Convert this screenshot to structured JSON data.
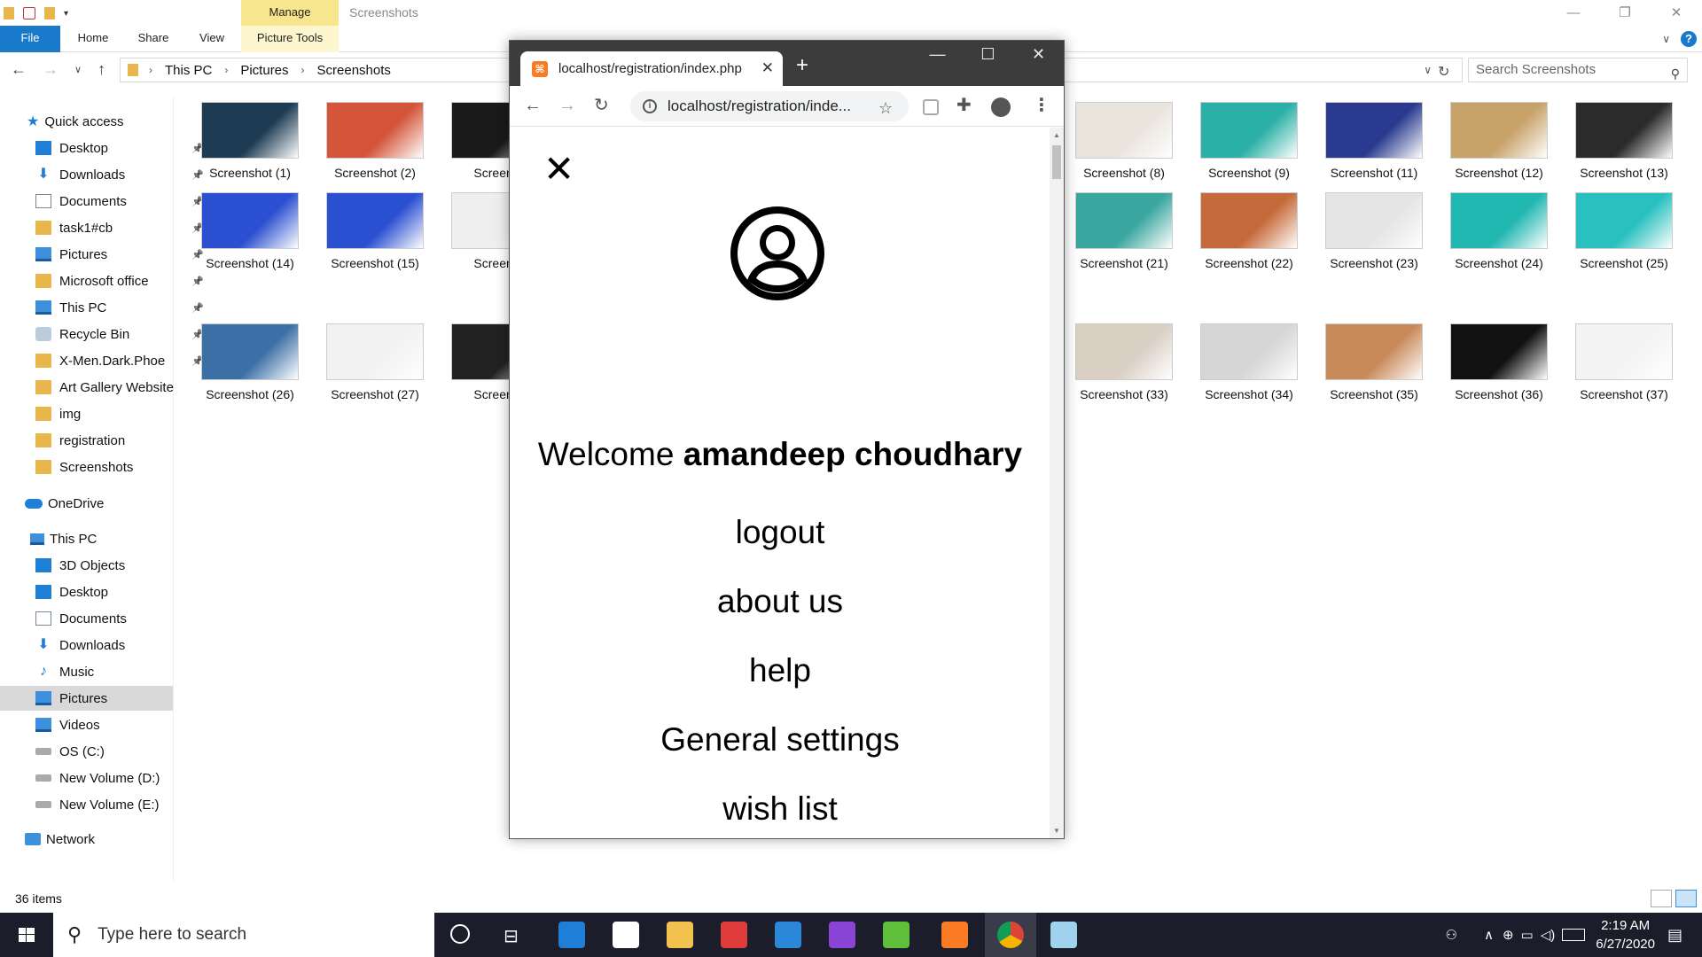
{
  "explorer": {
    "title": "Screenshots",
    "ribbon": {
      "contextual_tab": "Manage",
      "tabs": [
        "File",
        "Home",
        "Share",
        "View",
        "Picture Tools"
      ]
    },
    "breadcrumb": [
      "This PC",
      "Pictures",
      "Screenshots"
    ],
    "search_placeholder": "Search Screenshots",
    "nav": {
      "quick_access_label": "Quick access",
      "quick_access": [
        {
          "label": "Desktop",
          "icon": "desktop-icon",
          "pinned": true
        },
        {
          "label": "Downloads",
          "icon": "downloads-icon",
          "pinned": true
        },
        {
          "label": "Documents",
          "icon": "documents-icon",
          "pinned": true
        },
        {
          "label": "task1#cb",
          "icon": "folder-icon",
          "pinned": true
        },
        {
          "label": "Pictures",
          "icon": "pictures-icon",
          "pinned": true
        },
        {
          "label": "Microsoft office",
          "icon": "folder-icon",
          "pinned": true
        },
        {
          "label": "This PC",
          "icon": "this-pc-icon",
          "pinned": true
        },
        {
          "label": "Recycle Bin",
          "icon": "recycle-bin-icon",
          "pinned": true
        },
        {
          "label": "X-Men.Dark.Phoe",
          "icon": "folder-icon",
          "pinned": true
        },
        {
          "label": "Art Gallery Website",
          "icon": "folder-icon",
          "pinned": false
        },
        {
          "label": "img",
          "icon": "folder-icon",
          "pinned": false
        },
        {
          "label": "registration",
          "icon": "folder-icon",
          "pinned": false
        },
        {
          "label": "Screenshots",
          "icon": "folder-icon",
          "pinned": false
        }
      ],
      "onedrive_label": "OneDrive",
      "this_pc_label": "This PC",
      "this_pc": [
        {
          "label": "3D Objects",
          "icon": "3d-objects-icon"
        },
        {
          "label": "Desktop",
          "icon": "desktop-icon"
        },
        {
          "label": "Documents",
          "icon": "documents-icon"
        },
        {
          "label": "Downloads",
          "icon": "downloads-icon"
        },
        {
          "label": "Music",
          "icon": "music-icon"
        },
        {
          "label": "Pictures",
          "icon": "pictures-icon",
          "selected": true
        },
        {
          "label": "Videos",
          "icon": "videos-icon"
        },
        {
          "label": "OS (C:)",
          "icon": "drive-icon"
        },
        {
          "label": "New Volume (D:)",
          "icon": "drive-icon"
        },
        {
          "label": "New Volume (E:)",
          "icon": "drive-icon"
        }
      ],
      "network_label": "Network"
    },
    "thumbnails": [
      {
        "label": "Screenshot (1)",
        "color": "#1d3b52"
      },
      {
        "label": "Screenshot (2)",
        "color": "#d4553a"
      },
      {
        "label": "Screensh",
        "color": "#1a1a1a"
      },
      {
        "label": "Screenshot (8)",
        "color": "#e9e4dc"
      },
      {
        "label": "Screenshot (9)",
        "color": "#2ab0a6"
      },
      {
        "label": "Screenshot (11)",
        "color": "#2a3b8f"
      },
      {
        "label": "Screenshot (12)",
        "color": "#c7a36a"
      },
      {
        "label": "Screenshot (13)",
        "color": "#2b2b2b"
      },
      {
        "label": "Screenshot (14)",
        "color": "#2b4fd1"
      },
      {
        "label": "Screenshot (15)",
        "color": "#2b4fd1"
      },
      {
        "label": "Screensh",
        "color": "#eeeeee"
      },
      {
        "label": "Screenshot (21)",
        "color": "#3aa6a0"
      },
      {
        "label": "Screenshot (22)",
        "color": "#c56a3a"
      },
      {
        "label": "Screenshot (23)",
        "color": "#e4e4e4"
      },
      {
        "label": "Screenshot (24)",
        "color": "#1fb7b0"
      },
      {
        "label": "Screenshot (25)",
        "color": "#29c1c0"
      },
      {
        "label": "Screenshot (26)",
        "color": "#3c6fa6"
      },
      {
        "label": "Screenshot (27)",
        "color": "#f2f2f2"
      },
      {
        "label": "Screensh",
        "color": "#222222"
      },
      {
        "label": "Screenshot (33)",
        "color": "#d9cfc3"
      },
      {
        "label": "Screenshot (34)",
        "color": "#d6d6d6"
      },
      {
        "label": "Screenshot (35)",
        "color": "#c98a5a"
      },
      {
        "label": "Screenshot (36)",
        "color": "#111111"
      },
      {
        "label": "Screenshot (37)",
        "color": "#f4f4f4"
      }
    ],
    "status": {
      "item_count": "36 items"
    }
  },
  "browser": {
    "tab_title": "localhost/registration/index.php",
    "url": "localhost/registration/inde...",
    "page": {
      "welcome_prefix": "Welcome ",
      "username": "amandeep choudhary",
      "menu": [
        "logout",
        "about us",
        "help",
        "General settings",
        "wish list"
      ]
    }
  },
  "taskbar": {
    "search_placeholder": "Type here to search",
    "time": "2:19 AM",
    "date": "6/27/2020",
    "apps": [
      {
        "name": "edge-icon",
        "color": "#1f7fd6"
      },
      {
        "name": "store-icon",
        "color": "#ffffff"
      },
      {
        "name": "file-explorer-icon",
        "color": "#f2c14e"
      },
      {
        "name": "gift-icon",
        "color": "#e03b3b"
      },
      {
        "name": "mail-icon",
        "color": "#2b88d8"
      },
      {
        "name": "visual-studio-icon",
        "color": "#8b45d6"
      },
      {
        "name": "utorrent-icon",
        "color": "#5fbf3a"
      },
      {
        "name": "xampp-icon",
        "color": "#fb7a24"
      },
      {
        "name": "chrome-icon",
        "color": "#e8b52b"
      },
      {
        "name": "paint-icon",
        "color": "#9fd2ef"
      }
    ]
  }
}
